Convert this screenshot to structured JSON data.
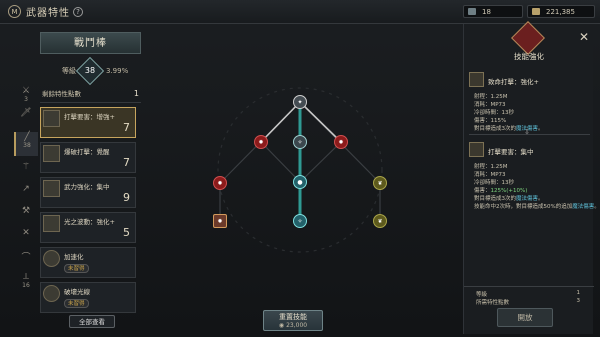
{
  "window": {
    "title": "武器特性",
    "help": "?"
  },
  "currency": {
    "a": "18",
    "b": "221,385"
  },
  "sidebar": {
    "counts": [
      "3",
      "38",
      "16"
    ]
  },
  "left": {
    "title": "戰鬥棒",
    "level_label": "等級",
    "level": "38",
    "percent": "3.99%",
    "remain_label": "剩餘特性點數",
    "remain": "1",
    "cards": [
      {
        "name": "打擊要害：增強+",
        "value": "7"
      },
      {
        "name": "爆破打擊：覺醒",
        "value": "7"
      },
      {
        "name": "武力強化：集中",
        "value": "9"
      },
      {
        "name": "光之波動：強化+",
        "value": "5"
      },
      {
        "name": "加速化",
        "badge": "未習得"
      },
      {
        "name": "破壞光線",
        "badge": "未習得"
      }
    ],
    "all_view": "全部查看"
  },
  "reset": {
    "label": "重置技能",
    "cost": "23,000"
  },
  "right": {
    "title": "技能強化",
    "skill1": {
      "name": "致命打擊：強化+",
      "l1": "射程：1.25M",
      "l2": "消耗：MP73",
      "l3": "冷卻時間：13秒",
      "l4": "傷害：115%",
      "l5a": "對目標造成3次的",
      "l5b": "魔法傷害",
      "l5c": "。"
    },
    "skill2": {
      "name": "打擊要害：集中",
      "l1": "射程：1.25M",
      "l2": "消耗：MP73",
      "l3": "冷卻時間：13秒",
      "l4a": "傷害：",
      "l4b": "125%(+10%)",
      "l5a": "對目標造成3次的",
      "l5b": "魔法傷害",
      "l5c": "。",
      "l6a": "技能命中2次時，對目標造成50%的追加",
      "l6b": "魔法傷害",
      "l6c": "。"
    },
    "level_row_label": "等級",
    "level_row_value": "1",
    "needed_label": "所需特性點數",
    "needed_value": "3",
    "open": "開放"
  },
  "colors": {
    "accent": "#c7a55e",
    "red": "#b02222",
    "teal": "#2f9a93",
    "olive": "#8a8a2a"
  }
}
